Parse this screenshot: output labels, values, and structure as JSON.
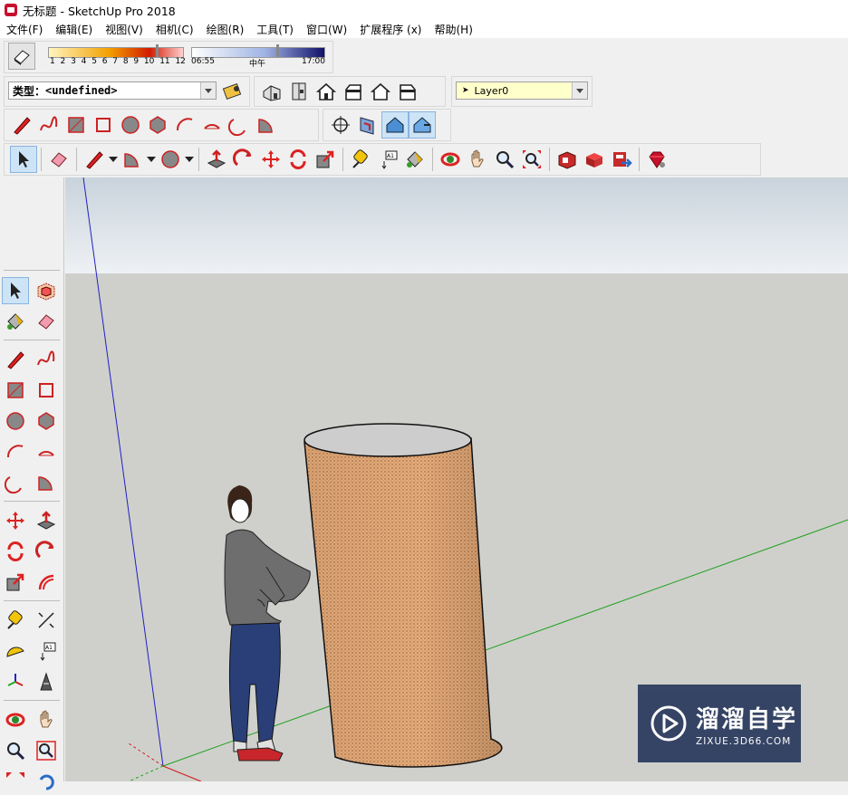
{
  "window": {
    "title": "无标题 - SketchUp Pro 2018"
  },
  "menu": [
    "文件(F)",
    "编辑(E)",
    "视图(V)",
    "相机(C)",
    "绘图(R)",
    "工具(T)",
    "窗口(W)",
    "扩展程序 (x)",
    "帮助(H)"
  ],
  "shadows": {
    "months": [
      "1",
      "2",
      "3",
      "4",
      "5",
      "6",
      "7",
      "8",
      "9",
      "10",
      "11",
      "12"
    ],
    "time_start": "06:55",
    "time_mid": "中午",
    "time_end": "17:00"
  },
  "type_selector": {
    "label": "类型：",
    "value": "<undefined>"
  },
  "layer": {
    "value": "Layer0"
  },
  "watermark": {
    "brand_cn": "溜溜自学",
    "brand_url": "ZIXUE.3D66.COM"
  },
  "colors": {
    "sky": "#dfe6ec",
    "ground": "#cfd0cc",
    "axis_red": "#d02020",
    "axis_green": "#20a020",
    "axis_blue": "#2020c0",
    "accent": "#c8102e"
  }
}
